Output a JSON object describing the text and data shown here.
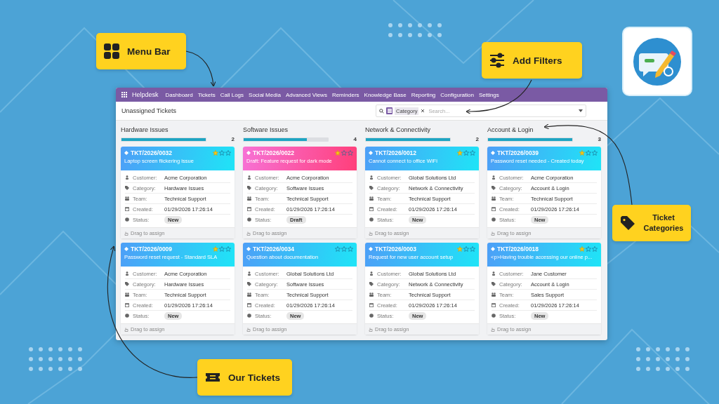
{
  "app": {
    "brand": "Helpdesk",
    "menu": [
      "Dashboard",
      "Tickets",
      "Call Logs",
      "Social Media",
      "Advanced Views",
      "Reminders",
      "Knowledge Base",
      "Reporting",
      "Configuration",
      "Settings"
    ]
  },
  "view": {
    "title": "Unassigned Tickets",
    "facet": "Category",
    "placeholder": "Search..."
  },
  "columns": [
    {
      "title": "Hardware Issues",
      "level": 1,
      "count": "2",
      "cards": [
        {
          "kind": "new",
          "ref": "TKT/2026/0032",
          "stars": 1,
          "summary": "Laptop screen flickering issue",
          "fields": [
            {
              "kind": "customer",
              "label": "Customer:",
              "value": "Acme Corporation"
            },
            {
              "kind": "category",
              "label": "Category:",
              "value": "Hardware Issues"
            },
            {
              "kind": "team",
              "label": "Team:",
              "value": "Technical Support"
            },
            {
              "kind": "created",
              "label": "Created:",
              "value": "01/29/2026 17:26:14"
            },
            {
              "kind": "status",
              "label": "Status:",
              "value": "New"
            }
          ],
          "footer": "Drag to assign"
        },
        {
          "kind": "new",
          "ref": "TKT/2026/0009",
          "stars": 1,
          "summary": "Password reset request - Standard SLA",
          "fields": [
            {
              "kind": "customer",
              "label": "Customer:",
              "value": "Acme Corporation"
            },
            {
              "kind": "category",
              "label": "Category:",
              "value": "Hardware Issues"
            },
            {
              "kind": "team",
              "label": "Team:",
              "value": "Technical Support"
            },
            {
              "kind": "created",
              "label": "Created:",
              "value": "01/29/2026 17:26:14"
            },
            {
              "kind": "status",
              "label": "Status:",
              "value": "New"
            }
          ],
          "footer": "Drag to assign"
        }
      ]
    },
    {
      "title": "Software Issues",
      "level": 0.75,
      "count": "4",
      "cards": [
        {
          "kind": "draft",
          "ref": "TKT/2026/0022",
          "stars": 1,
          "summary": "Draft: Feature request for dark mode",
          "fields": [
            {
              "kind": "customer",
              "label": "Customer:",
              "value": "Acme Corporation"
            },
            {
              "kind": "category",
              "label": "Category:",
              "value": "Software Issues"
            },
            {
              "kind": "team",
              "label": "Team:",
              "value": "Technical Support"
            },
            {
              "kind": "created",
              "label": "Created:",
              "value": "01/29/2026 17:26:14"
            },
            {
              "kind": "status",
              "label": "Status:",
              "value": "Draft"
            }
          ],
          "footer": "Drag to assign"
        },
        {
          "kind": "new",
          "ref": "TKT/2026/0034",
          "stars": 0,
          "summary": "Question about documentation",
          "fields": [
            {
              "kind": "customer",
              "label": "Customer:",
              "value": "Global Solutions Ltd"
            },
            {
              "kind": "category",
              "label": "Category:",
              "value": "Software Issues"
            },
            {
              "kind": "team",
              "label": "Team:",
              "value": "Technical Support"
            },
            {
              "kind": "created",
              "label": "Created:",
              "value": "01/29/2026 17:26:14"
            },
            {
              "kind": "status",
              "label": "Status:",
              "value": "New"
            }
          ],
          "footer": "Drag to assign"
        }
      ]
    },
    {
      "title": "Network & Connectivity",
      "level": 1,
      "count": "2",
      "cards": [
        {
          "kind": "new",
          "ref": "TKT/2026/0012",
          "stars": 1,
          "summary": "Cannot connect to office WiFi",
          "fields": [
            {
              "kind": "customer",
              "label": "Customer:",
              "value": "Global Solutions Ltd"
            },
            {
              "kind": "category",
              "label": "Category:",
              "value": "Network & Connectivity"
            },
            {
              "kind": "team",
              "label": "Team:",
              "value": "Technical Support"
            },
            {
              "kind": "created",
              "label": "Created:",
              "value": "01/29/2026 17:26:14"
            },
            {
              "kind": "status",
              "label": "Status:",
              "value": "New"
            }
          ],
          "footer": "Drag to assign"
        },
        {
          "kind": "new",
          "ref": "TKT/2026/0003",
          "stars": 1,
          "summary": "Request for new user account setup",
          "fields": [
            {
              "kind": "customer",
              "label": "Customer:",
              "value": "Global Solutions Ltd"
            },
            {
              "kind": "category",
              "label": "Category:",
              "value": "Network & Connectivity"
            },
            {
              "kind": "team",
              "label": "Team:",
              "value": "Technical Support"
            },
            {
              "kind": "created",
              "label": "Created:",
              "value": "01/29/2026 17:26:14"
            },
            {
              "kind": "status",
              "label": "Status:",
              "value": "New"
            }
          ],
          "footer": "Drag to assign"
        }
      ]
    },
    {
      "title": "Account & Login",
      "level": 1,
      "count": "3",
      "cards": [
        {
          "kind": "new",
          "ref": "TKT/2026/0039",
          "stars": 1,
          "summary": "Password reset needed - Created today",
          "fields": [
            {
              "kind": "customer",
              "label": "Customer:",
              "value": "Acme Corporation"
            },
            {
              "kind": "category",
              "label": "Category:",
              "value": "Account & Login"
            },
            {
              "kind": "team",
              "label": "Team:",
              "value": "Technical Support"
            },
            {
              "kind": "created",
              "label": "Created:",
              "value": "01/29/2026 17:26:14"
            },
            {
              "kind": "status",
              "label": "Status:",
              "value": "New"
            }
          ],
          "footer": "Drag to assign"
        },
        {
          "kind": "new",
          "ref": "TKT/2026/0018",
          "stars": 1,
          "summary": "<p>Having trouble accessing our online p...",
          "fields": [
            {
              "kind": "customer",
              "label": "Customer:",
              "value": "Jane Customer"
            },
            {
              "kind": "category",
              "label": "Category:",
              "value": "Account & Login"
            },
            {
              "kind": "team",
              "label": "Team:",
              "value": "Sales Support"
            },
            {
              "kind": "created",
              "label": "Created:",
              "value": "01/29/2026 17:26:14"
            },
            {
              "kind": "status",
              "label": "Status:",
              "value": "New"
            }
          ],
          "footer": "Drag to assign"
        }
      ]
    }
  ],
  "callouts": [
    {
      "kind": "grid",
      "label": "Menu Bar"
    },
    {
      "kind": "sliders",
      "label": "Add Filters"
    },
    {
      "kind": "tag",
      "label": "Ticket Categories"
    },
    {
      "kind": "ticket",
      "label": "Our Tickets"
    }
  ]
}
